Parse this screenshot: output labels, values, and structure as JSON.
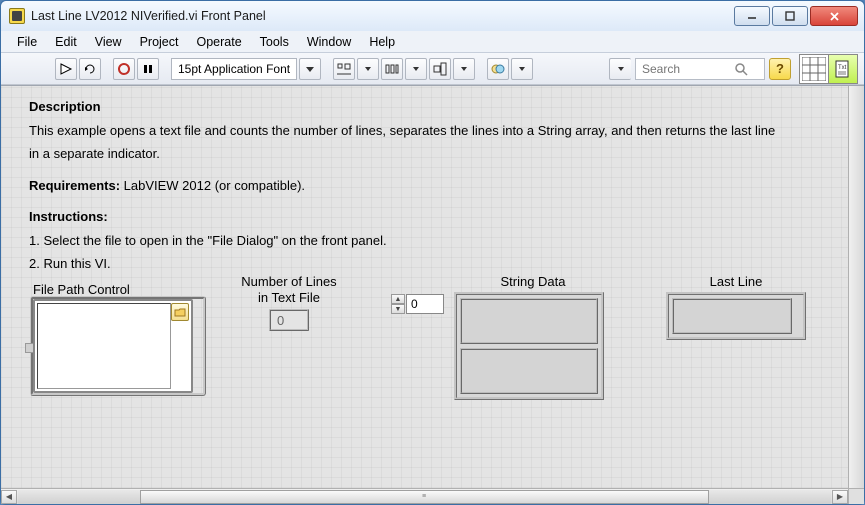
{
  "window": {
    "title": "Last Line LV2012 NIVerified.vi Front Panel"
  },
  "menu": {
    "file": "File",
    "edit": "Edit",
    "view": "View",
    "project": "Project",
    "operate": "Operate",
    "tools": "Tools",
    "window": "Window",
    "help": "Help"
  },
  "toolbar": {
    "font_label": "15pt Application Font",
    "search_placeholder": "Search",
    "help_glyph": "?"
  },
  "description": {
    "heading": "Description",
    "body1": "This example opens a text file and counts the number of lines, separates the lines into a String array, and then returns the last line",
    "body2": "in a separate indicator.",
    "req_label": "Requirements:",
    "req_text": " LabVIEW 2012 (or compatible).",
    "instr_label": "Instructions:",
    "instr1": "1. Select the file to open in the \"File Dialog\" on the front panel.",
    "instr2": "2. Run this VI."
  },
  "controls": {
    "file_path_label": "File Path Control",
    "num_lines_label_1": "Number of Lines",
    "num_lines_label_2": "in Text File",
    "num_lines_value": "0",
    "array_index": "0",
    "string_data_label": "String Data",
    "last_line_label": "Last Line"
  }
}
